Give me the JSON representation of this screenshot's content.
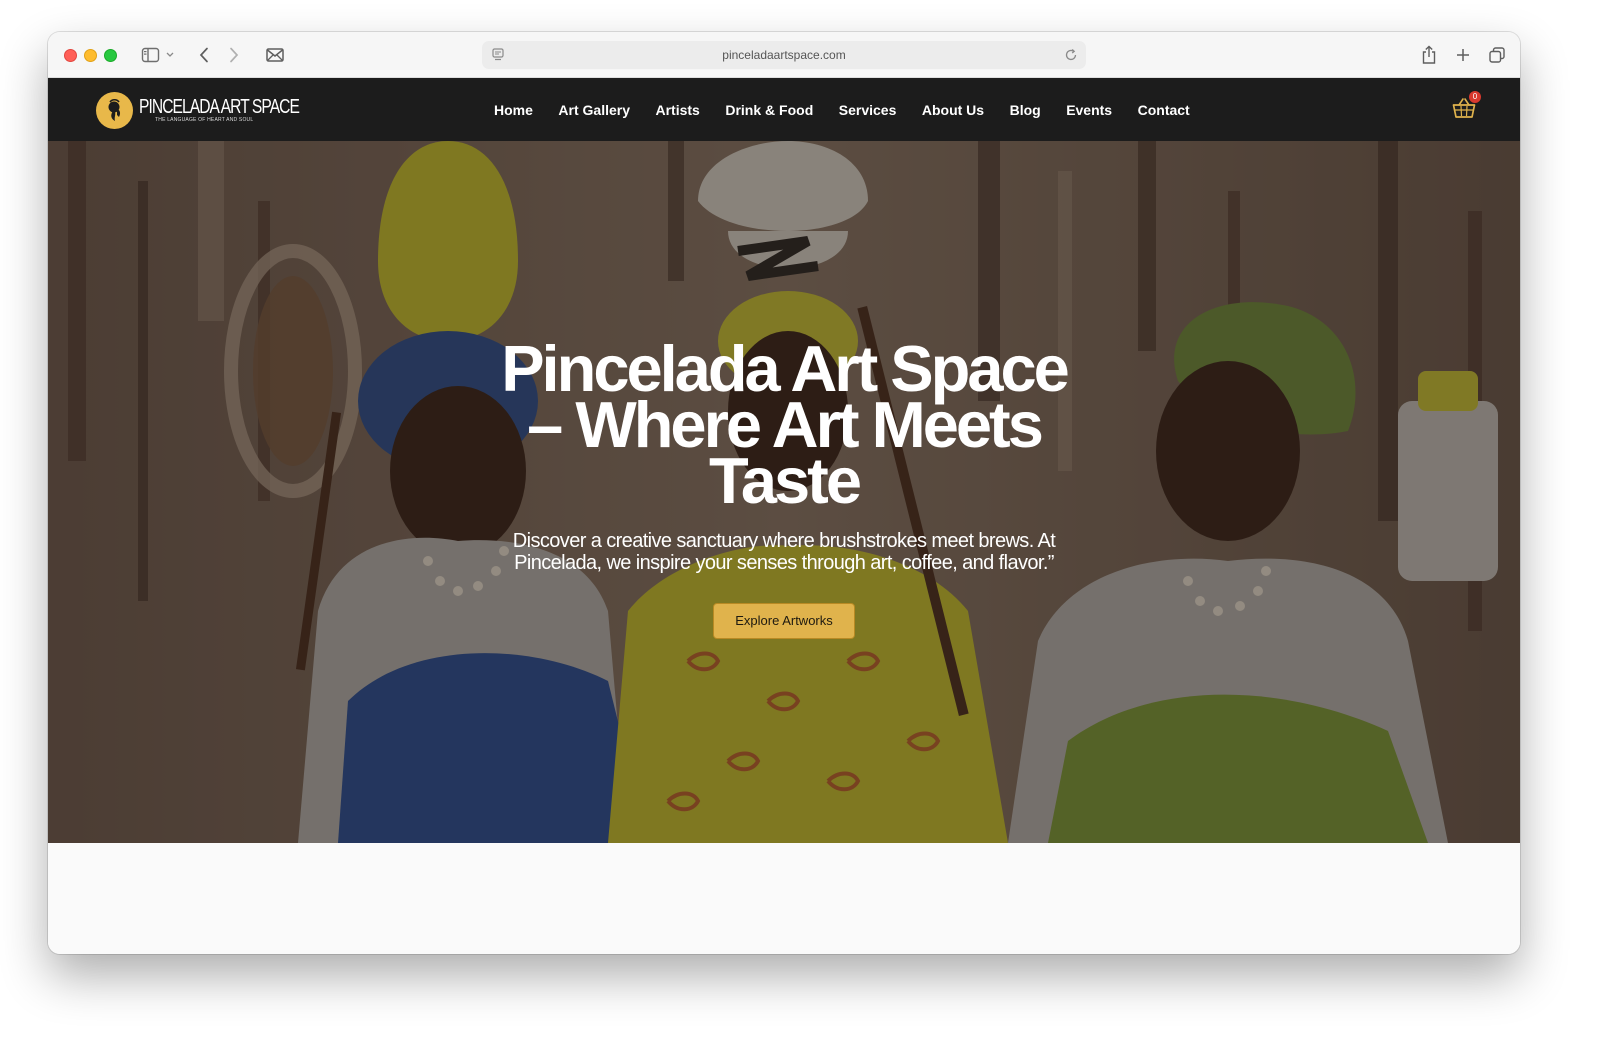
{
  "browser": {
    "url": "pinceladaartspace.com"
  },
  "site": {
    "logo_name": "PINCELADA ART SPACE",
    "logo_tagline": "THE LANGUAGE OF HEART AND SOUL",
    "nav": [
      {
        "label": "Home"
      },
      {
        "label": "Art Gallery"
      },
      {
        "label": "Artists"
      },
      {
        "label": "Drink & Food"
      },
      {
        "label": "Services"
      },
      {
        "label": "About Us"
      },
      {
        "label": "Blog"
      },
      {
        "label": "Events"
      },
      {
        "label": "Contact"
      }
    ],
    "cart_count": "0"
  },
  "hero": {
    "title": "Pincelada Art Space – Where Art Meets Taste",
    "subtitle": "Discover a creative sanctuary where brushstrokes meet brews. At Pincelada, we inspire your senses through art, coffee, and flavor.”",
    "cta": "Explore Artworks",
    "image": "painting of three women carrying pots on their heads"
  },
  "colors": {
    "header_bg": "#1c1c1c",
    "accent": "#e0b34c",
    "badge": "#d9392e"
  }
}
